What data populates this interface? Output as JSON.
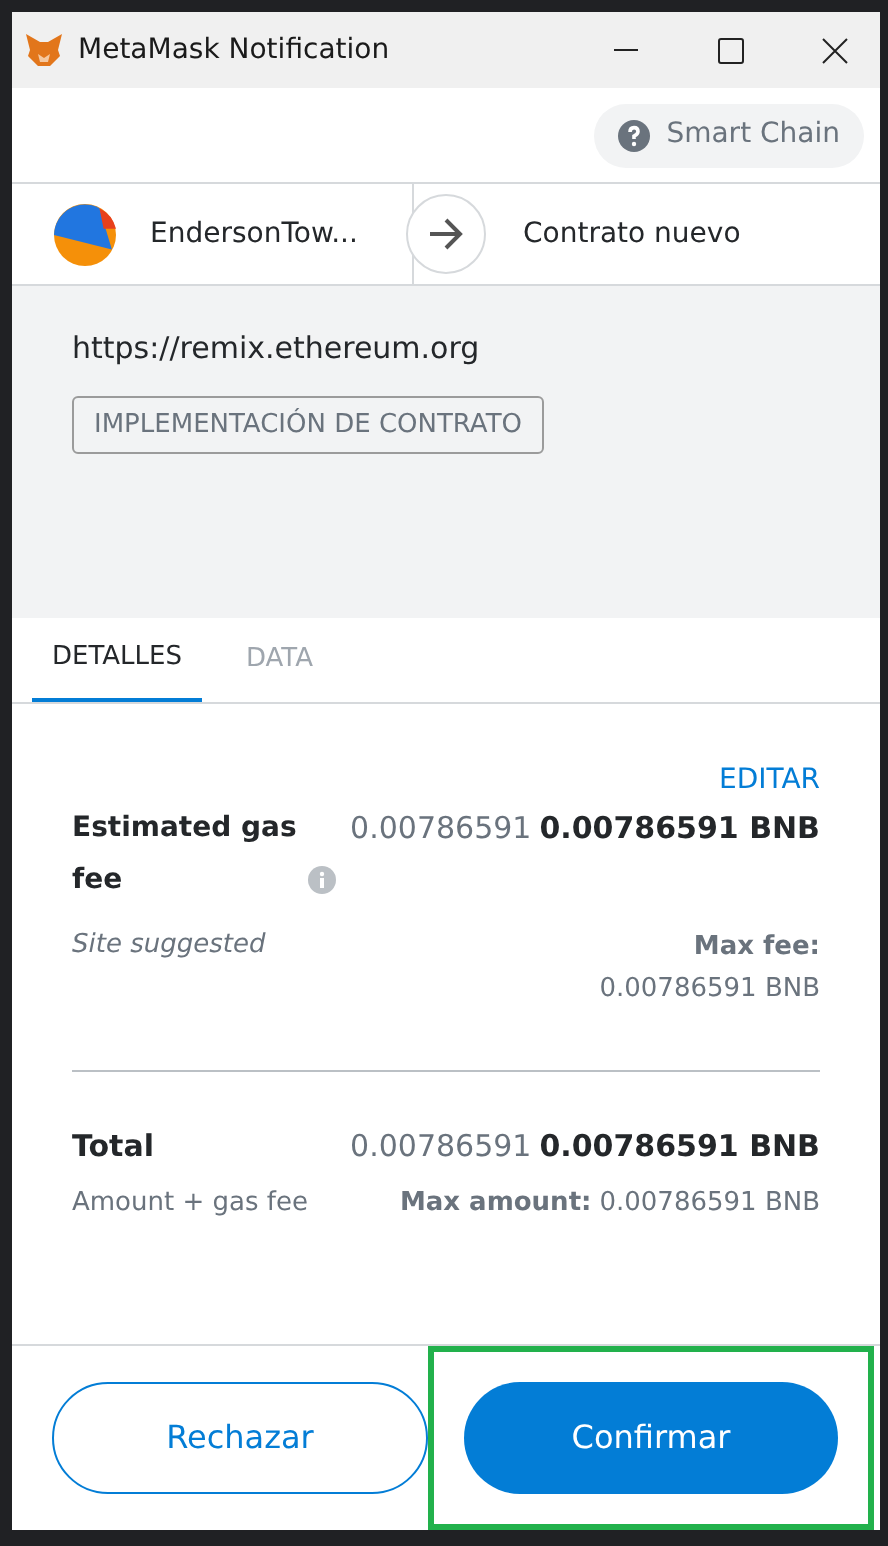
{
  "window": {
    "title": "MetaMask Notification"
  },
  "network": {
    "label": "Smart Chain"
  },
  "transfer": {
    "from": "EndersonTow...",
    "to": "Contrato nuevo"
  },
  "origin": {
    "url": "https://remix.ethereum.org",
    "badge": "IMPLEMENTACIÓN DE CONTRATO"
  },
  "tabs": [
    {
      "label": "DETALLES",
      "selected": true
    },
    {
      "label": "DATA",
      "selected": false
    }
  ],
  "edit_link": "EDITAR",
  "gas": {
    "label": "Estimated gas fee",
    "secondary": "0.00786591",
    "primary": "0.00786591 BNB",
    "note": "Site suggested",
    "max_label": "Max fee:",
    "max_value": "0.00786591 BNB"
  },
  "total": {
    "label": "Total",
    "secondary": "0.00786591",
    "primary": "0.00786591 BNB",
    "note": "Amount + gas fee",
    "max_label": "Max amount:",
    "max_value": "0.00786591 BNB"
  },
  "buttons": [
    {
      "label": "Rechazar",
      "kind": "secondary",
      "highlighted": false
    },
    {
      "label": "Confirmar",
      "kind": "primary",
      "highlighted": true
    }
  ]
}
